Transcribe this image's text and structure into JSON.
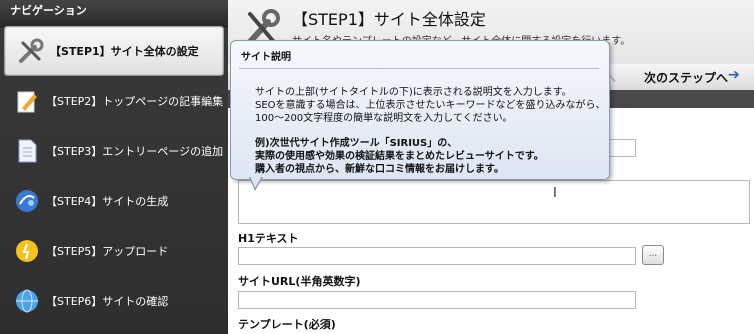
{
  "sidebar": {
    "title": "ナビゲーション",
    "items": [
      {
        "label": "【STEP1】サイト全体の設定",
        "icon": "tools-icon"
      },
      {
        "label": "【STEP2】トップページの記事編集",
        "icon": "pencil-icon"
      },
      {
        "label": "【STEP3】エントリーページの追加",
        "icon": "document-icon"
      },
      {
        "label": "【STEP4】サイトの生成",
        "icon": "generate-icon"
      },
      {
        "label": "【STEP5】アップロード",
        "icon": "bulb-icon"
      },
      {
        "label": "【STEP6】サイトの確認",
        "icon": "globe-icon"
      }
    ]
  },
  "header": {
    "title": "【STEP1】サイト全体設定",
    "description": "サイト名やテンプレートの設定など、サイト全体に関する設定を行います。"
  },
  "step_nav": {
    "prev_label": "プへ",
    "next_label": "次のステップへ"
  },
  "form": {
    "h1_label": "H1テキスト",
    "url_label": "サイトURL(半角英数字)",
    "template_label": "テンプレート(必須)",
    "browse_button": "..."
  },
  "tooltip": {
    "title": "サイト説明",
    "lines": [
      "サイトの上部(サイトタイトルの下)に表示される説明文を入力します。",
      "SEOを意識する場合は、上位表示させたいキーワードなどを盛り込みながら、",
      "100〜200文字程度の簡単な説明文を入力してください。"
    ],
    "example_lines": [
      "例)次世代サイト作成ツール「SIRIUS」の、",
      "実際の使用感や効果の検証結果をまとめたレビューサイトです。",
      "購入者の視点から、新鮮な口コミ情報をお届けします。"
    ]
  },
  "colors": {
    "sidebar_bg": "#333333",
    "accent_arrow": "#2d5fb5",
    "tooltip_bg": "#e6ecf6"
  }
}
